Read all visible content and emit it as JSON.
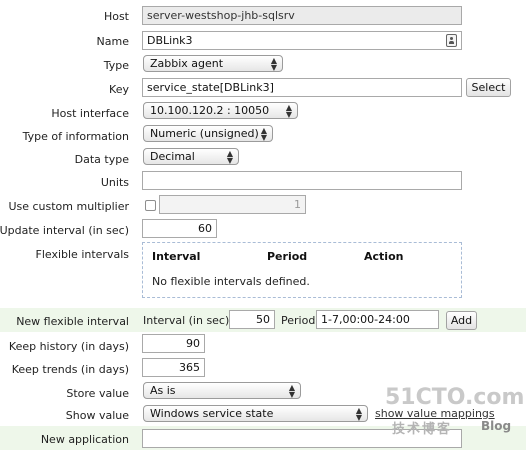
{
  "form": {
    "host": {
      "label": "Host",
      "value": "server-westshop-jhb-sqlsrv"
    },
    "name": {
      "label": "Name",
      "value": "DBLink3"
    },
    "type": {
      "label": "Type",
      "value": "Zabbix agent"
    },
    "key": {
      "label": "Key",
      "value": "service_state[DBLink3]",
      "select_label": "Select"
    },
    "host_interface": {
      "label": "Host interface",
      "value": "10.100.120.2 : 10050"
    },
    "type_of_information": {
      "label": "Type of information",
      "value": "Numeric (unsigned)"
    },
    "data_type": {
      "label": "Data type",
      "value": "Decimal"
    },
    "units": {
      "label": "Units",
      "value": ""
    },
    "custom_multiplier": {
      "label": "Use custom multiplier",
      "checked": false,
      "value": "1"
    },
    "update_interval": {
      "label": "Update interval (in sec)",
      "value": "60"
    },
    "flexible_intervals": {
      "label": "Flexible intervals",
      "columns": [
        "Interval",
        "Period",
        "Action"
      ],
      "empty_text": "No flexible intervals defined."
    },
    "new_flexible_interval": {
      "label": "New flexible interval",
      "interval_label": "Interval (in sec)",
      "interval_value": "50",
      "period_label": "Period",
      "period_value": "1-7,00:00-24:00",
      "add_label": "Add"
    },
    "keep_history": {
      "label": "Keep history (in days)",
      "value": "90"
    },
    "keep_trends": {
      "label": "Keep trends (in days)",
      "value": "365"
    },
    "store_value": {
      "label": "Store value",
      "value": "As is"
    },
    "show_value": {
      "label": "Show value",
      "value": "Windows service state",
      "link_label": "show value mappings"
    },
    "new_application": {
      "label": "New application",
      "value": ""
    }
  },
  "watermark": {
    "site": "51CTO.com",
    "tagline": "技术博客",
    "blog": "Blog"
  },
  "colors": {
    "band": "#eef7ea",
    "readonly_bg": "#ebebeb",
    "dashed_border": "#a9bcd6"
  }
}
